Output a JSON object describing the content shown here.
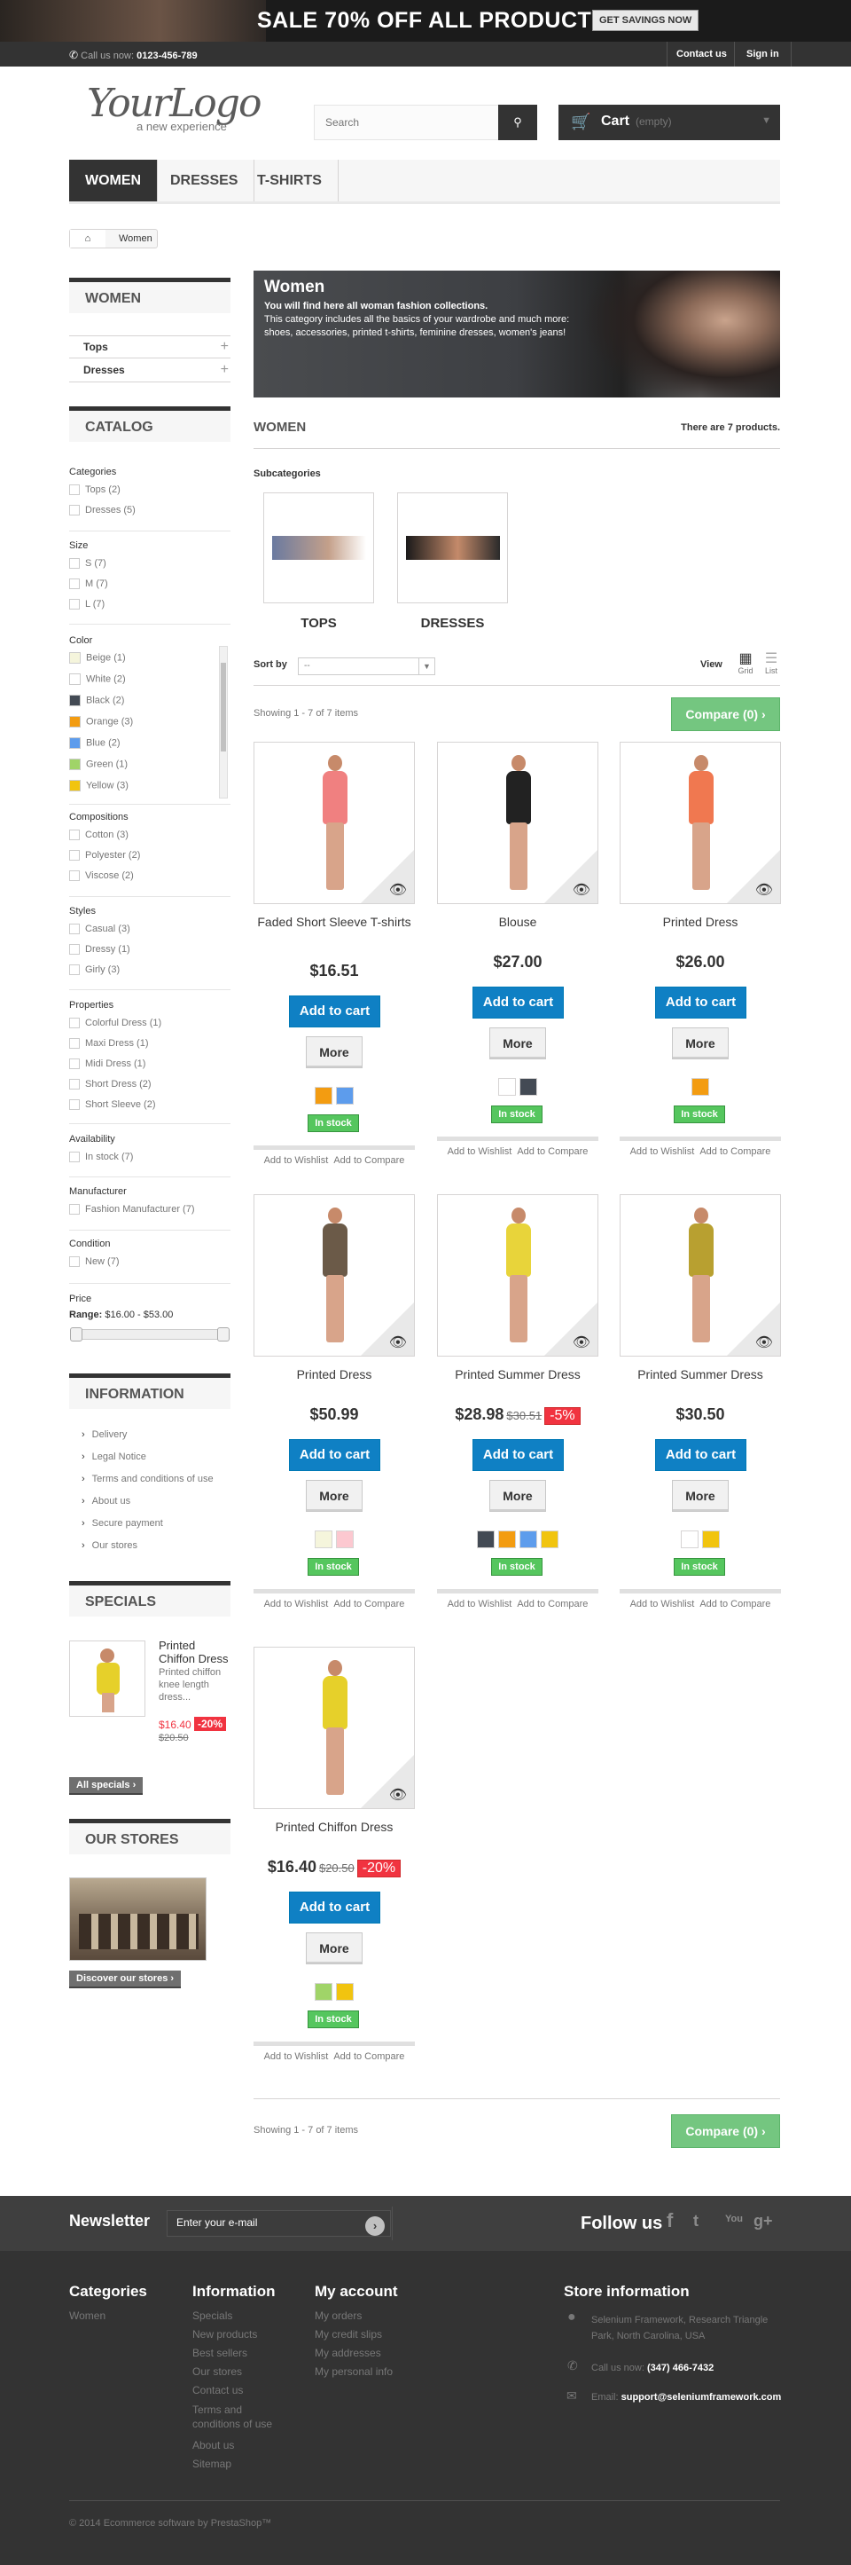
{
  "promo": {
    "text": "SALE 70% OFF ALL PRODUCTS",
    "button": "GET SAVINGS NOW"
  },
  "topbar": {
    "call_label": "Call us now:",
    "phone": "0123-456-789",
    "contact": "Contact us",
    "signin": "Sign in"
  },
  "header": {
    "logo_text": "YourLogo",
    "logo_tagline": "a new experience",
    "search_placeholder": "Search",
    "cart_label": "Cart",
    "cart_status": "(empty)"
  },
  "nav": [
    "WOMEN",
    "DRESSES",
    "T-SHIRTS"
  ],
  "breadcrumb": {
    "current": "Women"
  },
  "sidebar": {
    "women_title": "WOMEN",
    "women_items": [
      "Tops",
      "Dresses"
    ],
    "catalog_title": "CATALOG",
    "filters": {
      "categories": {
        "label": "Categories",
        "items": [
          "Tops (2)",
          "Dresses (5)"
        ]
      },
      "size": {
        "label": "Size",
        "items": [
          "S (7)",
          "M (7)",
          "L (7)"
        ]
      },
      "color": {
        "label": "Color",
        "items": [
          {
            "label": "Beige (1)",
            "color": "#f5f5dc"
          },
          {
            "label": "White (2)",
            "color": "#ffffff"
          },
          {
            "label": "Black (2)",
            "color": "#434a54"
          },
          {
            "label": "Orange (3)",
            "color": "#f39c11"
          },
          {
            "label": "Blue (2)",
            "color": "#5d9cec"
          },
          {
            "label": "Green (1)",
            "color": "#a0d468"
          },
          {
            "label": "Yellow (3)",
            "color": "#f1c40f"
          }
        ]
      },
      "compositions": {
        "label": "Compositions",
        "items": [
          "Cotton (3)",
          "Polyester (2)",
          "Viscose (2)"
        ]
      },
      "styles": {
        "label": "Styles",
        "items": [
          "Casual (3)",
          "Dressy (1)",
          "Girly (3)"
        ]
      },
      "properties": {
        "label": "Properties",
        "items": [
          "Colorful Dress (1)",
          "Maxi Dress (1)",
          "Midi Dress (1)",
          "Short Dress (2)",
          "Short Sleeve (2)"
        ]
      },
      "availability": {
        "label": "Availability",
        "items": [
          "In stock (7)"
        ]
      },
      "manufacturer": {
        "label": "Manufacturer",
        "items": [
          "Fashion Manufacturer (7)"
        ]
      },
      "condition": {
        "label": "Condition",
        "items": [
          "New (7)"
        ]
      },
      "price": {
        "label": "Price",
        "range_label": "Range:",
        "range": "$16.00 - $53.00"
      }
    },
    "information_title": "INFORMATION",
    "information_items": [
      "Delivery",
      "Legal Notice",
      "Terms and conditions of use",
      "About us",
      "Secure payment",
      "Our stores"
    ],
    "specials_title": "SPECIALS",
    "special": {
      "name": "Printed Chiffon Dress",
      "desc": "Printed chiffon knee length dress...",
      "price": "$16.40",
      "discount": "-20%",
      "old_price": "$20.50"
    },
    "all_specials": "All specials",
    "stores_title": "OUR STORES",
    "discover": "Discover our stores"
  },
  "category": {
    "title": "Women",
    "desc_bold": "You will find here all woman fashion collections.",
    "desc": "This category includes all the basics of your wardrobe and much more: shoes, accessories, printed t-shirts, feminine dresses, women's jeans!",
    "heading": "WOMEN",
    "count_text": "There are 7 products.",
    "subcategories_label": "Subcategories",
    "subcategories": [
      "TOPS",
      "DRESSES"
    ]
  },
  "toolbar": {
    "sort_label": "Sort by",
    "sort_value": "--",
    "view_label": "View",
    "grid": "Grid",
    "list": "List",
    "showing": "Showing 1 - 7 of 7 items",
    "compare": "Compare (0)"
  },
  "product_labels": {
    "add_to_cart": "Add to cart",
    "more": "More",
    "stock": "In stock",
    "wishlist": "Add to Wishlist",
    "compare": "Add to Compare"
  },
  "products": [
    {
      "name": "Faded Short Sleeve T-shirts",
      "price": "$16.51",
      "old_price": "",
      "discount": "",
      "colors": [
        "#f39c11",
        "#5d9cec"
      ],
      "dress": "#f08080"
    },
    {
      "name": "Blouse",
      "price": "$27.00",
      "old_price": "",
      "discount": "",
      "colors": [
        "#ffffff",
        "#434a54"
      ],
      "dress": "#222222"
    },
    {
      "name": "Printed Dress",
      "price": "$26.00",
      "old_price": "",
      "discount": "",
      "colors": [
        "#f39c11"
      ],
      "dress": "#f07850"
    },
    {
      "name": "Printed Dress",
      "price": "$50.99",
      "old_price": "",
      "discount": "",
      "colors": [
        "#f5f5dc",
        "#fcc8d0"
      ],
      "dress": "#6b5a48"
    },
    {
      "name": "Printed Summer Dress",
      "price": "$28.98",
      "old_price": "$30.51",
      "discount": "-5%",
      "colors": [
        "#434a54",
        "#f39c11",
        "#5d9cec",
        "#f1c40f"
      ],
      "dress": "#e8d43a"
    },
    {
      "name": "Printed Summer Dress",
      "price": "$30.50",
      "old_price": "",
      "discount": "",
      "colors": [
        "#ffffff",
        "#f1c40f"
      ],
      "dress": "#b8a030"
    },
    {
      "name": "Printed Chiffon Dress",
      "price": "$16.40",
      "old_price": "$20.50",
      "discount": "-20%",
      "colors": [
        "#a0d468",
        "#f1c40f"
      ],
      "dress": "#e6d02a"
    }
  ],
  "newsletter": {
    "title": "Newsletter",
    "placeholder": "Enter your e-mail",
    "follow": "Follow us",
    "social": [
      "f",
      "t",
      "You",
      "g+"
    ]
  },
  "footer": {
    "categories": {
      "title": "Categories",
      "items": [
        "Women"
      ]
    },
    "information": {
      "title": "Information",
      "items": [
        "Specials",
        "New products",
        "Best sellers",
        "Our stores",
        "Contact us",
        "Terms and conditions of use",
        "About us",
        "Sitemap"
      ]
    },
    "account": {
      "title": "My account",
      "items": [
        "My orders",
        "My credit slips",
        "My addresses",
        "My personal info"
      ]
    },
    "store": {
      "title": "Store information",
      "address": "Selenium Framework, Research Triangle Park, North Carolina, USA",
      "call_label": "Call us now:",
      "phone": "(347) 466-7432",
      "email_label": "Email:",
      "email": "support@seleniumframework.com"
    },
    "copyright": "© 2014 Ecommerce software by PrestaShop™"
  }
}
